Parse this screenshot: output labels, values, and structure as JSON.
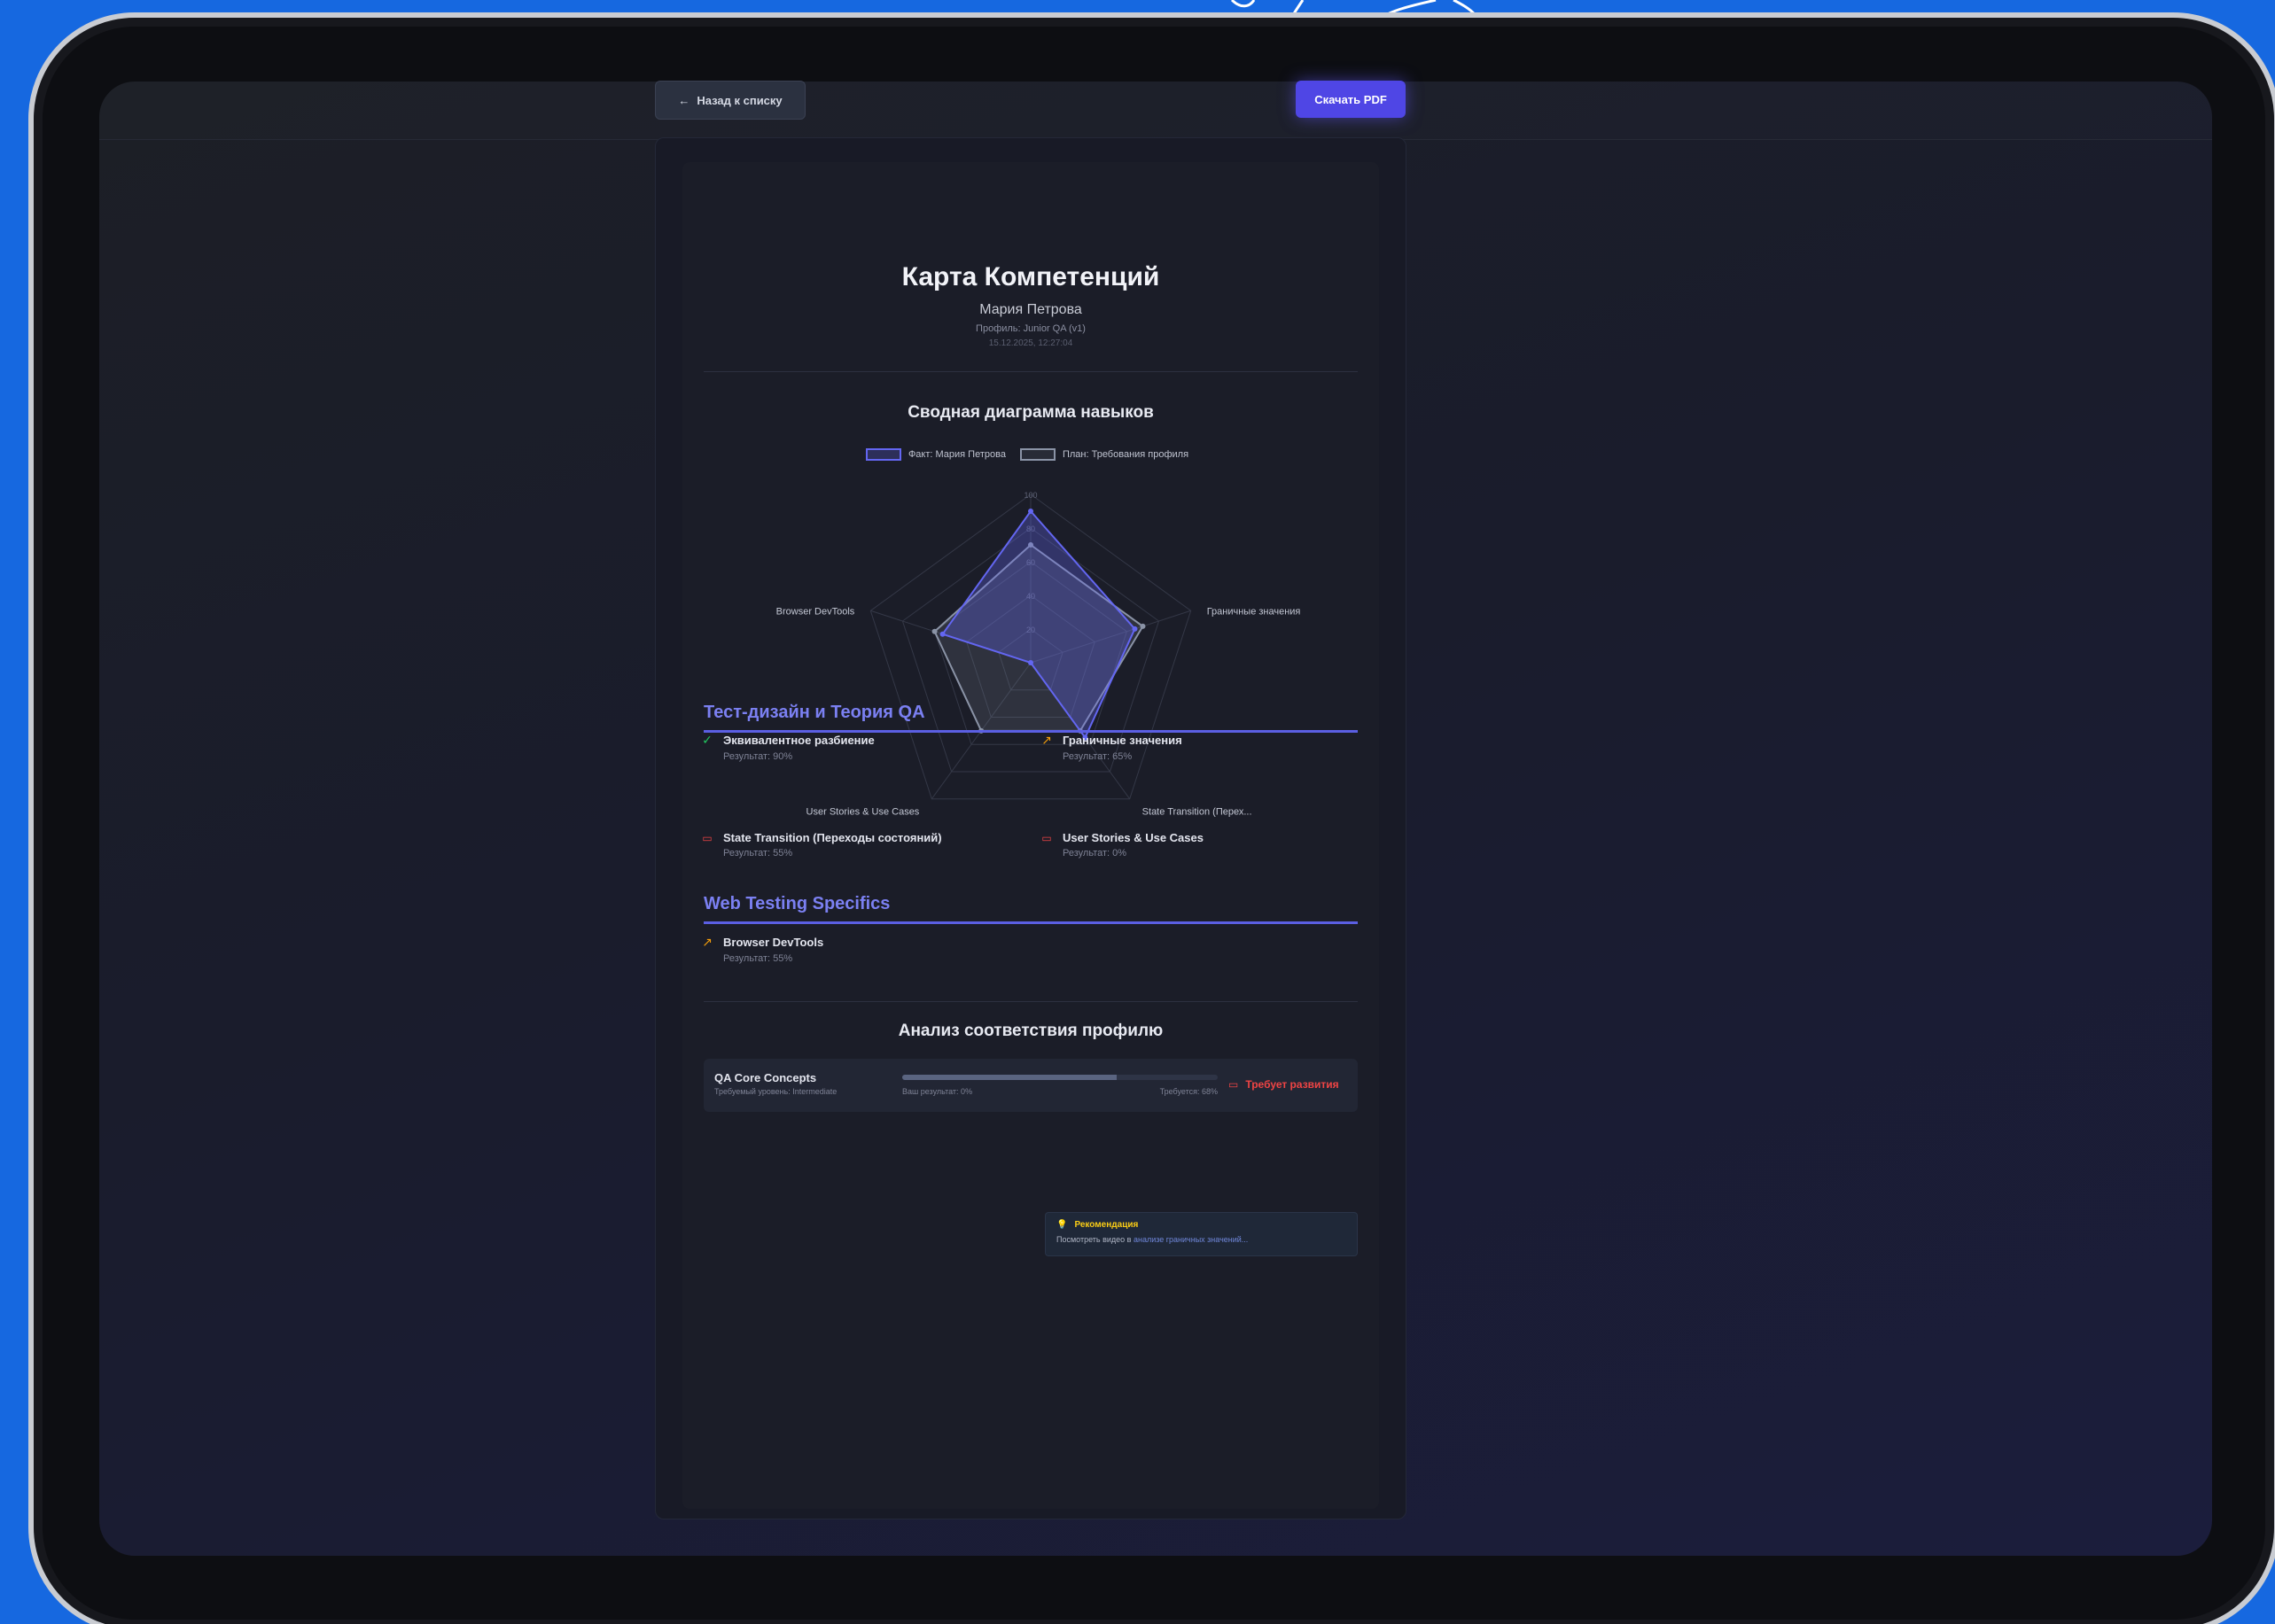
{
  "header": {
    "back_label": "Назад к списку",
    "pdf_label": "Скачать PDF"
  },
  "report": {
    "title": "Карта Компетенций",
    "name": "Мария Петрова",
    "profile": "Профиль: Junior QA (v1)",
    "date": "15.12.2025, 12:27:04"
  },
  "chart_data": {
    "type": "radar",
    "title": "Сводная диаграмма навыков",
    "axes": [
      "Эквивалентное разбиение",
      "Граничные значения",
      "State Transition (Перех...",
      "User Stories & Use Cases",
      "Browser DevTools"
    ],
    "ticks": [
      "20",
      "40",
      "60",
      "80",
      "100"
    ],
    "range": [
      0,
      100
    ],
    "series": [
      {
        "name": "Факт: Мария Петрова",
        "values": [
          90,
          65,
          55,
          0,
          55
        ],
        "color": "#6366f1"
      },
      {
        "name": "План: Требования профиля",
        "values": [
          70,
          70,
          50,
          50,
          60
        ],
        "color": "#8a93a6"
      }
    ],
    "legend_position": "top"
  },
  "sections": [
    {
      "title": "Тест-дизайн и Теория QA",
      "skills": [
        {
          "name": "Эквивалентное разбиение",
          "result": "Результат: 90%",
          "status": "ok"
        },
        {
          "name": "Граничные значения",
          "result": "Результат: 65%",
          "status": "up"
        },
        {
          "name": "State Transition (Переходы состояний)",
          "result": "Результат: 55%",
          "status": "book"
        },
        {
          "name": "User Stories & Use Cases",
          "result": "Результат: 0%",
          "status": "book"
        }
      ]
    },
    {
      "title": "Web Testing Specifics",
      "skills": [
        {
          "name": "Browser DevTools",
          "result": "Результат: 55%",
          "status": "up"
        }
      ]
    }
  ],
  "recommendation": {
    "heading": "Рекомендация",
    "text_prefix": "Посмотреть видео в ",
    "text_link": "анализе граничных значений..."
  },
  "analysis": {
    "title": "Анализ соответствия профилю",
    "rows": [
      {
        "name": "QA Core Concepts",
        "sub": "Требуемый уровень: Intermediate",
        "yours": "Ваш результат: 0%",
        "required": "Требуется: 68%",
        "progress": 0.68,
        "status": "Требует развития"
      }
    ]
  },
  "colors": {
    "accent": "#4f46e5",
    "fact": "#6366f1",
    "plan": "#8a93a6",
    "ok": "#22c55e",
    "warn": "#f59e0b",
    "bad": "#ef4444"
  }
}
